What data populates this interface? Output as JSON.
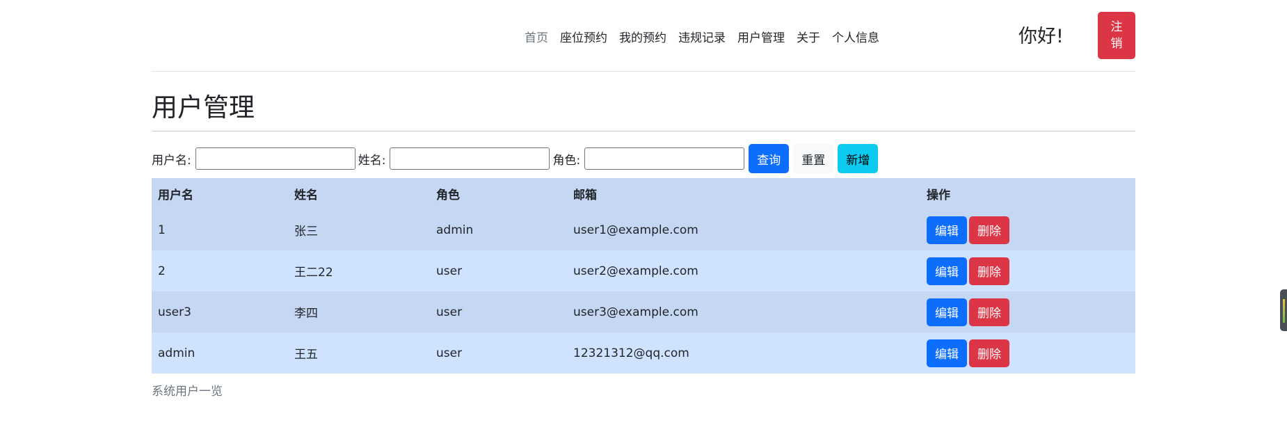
{
  "nav": {
    "items": [
      "首页",
      "座位预约",
      "我的预约",
      "违规记录",
      "用户管理",
      "关于",
      "个人信息"
    ]
  },
  "header": {
    "greeting": "你好!",
    "logout_label": "注销"
  },
  "page": {
    "title": "用户管理",
    "caption": "系统用户一览"
  },
  "search": {
    "username_label": "用户名:",
    "name_label": "姓名:",
    "role_label": "角色:",
    "username_value": "",
    "name_value": "",
    "role_value": "",
    "query_label": "查询",
    "reset_label": "重置",
    "add_label": "新增"
  },
  "table": {
    "headers": [
      "用户名",
      "姓名",
      "角色",
      "邮箱",
      "操作"
    ],
    "rows": [
      {
        "username": "1",
        "name": "张三",
        "role": "admin",
        "email": "user1@example.com",
        "edit": "编辑",
        "delete": "删除"
      },
      {
        "username": "2",
        "name": "王二22",
        "role": "user",
        "email": "user2@example.com",
        "edit": "编辑",
        "delete": "删除"
      },
      {
        "username": "user3",
        "name": "李四",
        "role": "user",
        "email": "user3@example.com",
        "edit": "编辑",
        "delete": "删除"
      },
      {
        "username": "admin",
        "name": "王五",
        "role": "user",
        "email": "12321312@qq.com",
        "edit": "编辑",
        "delete": "删除"
      }
    ]
  },
  "colors": {
    "primary": "#0d6efd",
    "danger": "#dc3545",
    "info": "#0dcaf0",
    "table_row_a": "#c5d7f2",
    "table_row_b": "#cfe2ff"
  }
}
